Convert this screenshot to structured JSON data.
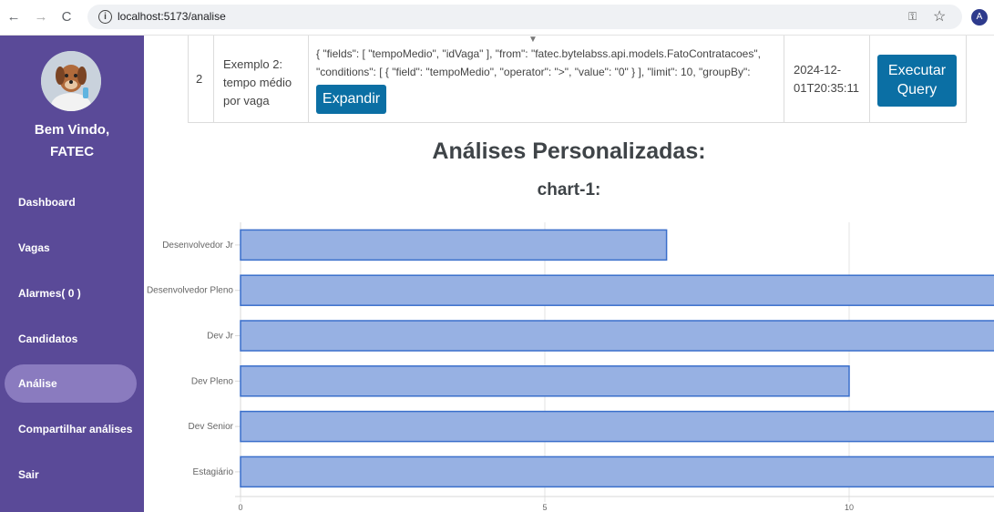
{
  "browser": {
    "url": "localhost:5173/analise",
    "profile_initial": "A"
  },
  "sidebar": {
    "welcome_line1": "Bem Vindo,",
    "welcome_line2": "FATEC",
    "items": [
      {
        "label": "Dashboard"
      },
      {
        "label": "Vagas"
      },
      {
        "label": "Alarmes( 0 )"
      },
      {
        "label": "Candidatos"
      },
      {
        "label": "Análise"
      },
      {
        "label": "Compartilhar análises"
      },
      {
        "label": "Sair"
      }
    ]
  },
  "query_row": {
    "index": "2",
    "name_lines": [
      "Exemplo 2:",
      "tempo médio",
      "por vaga"
    ],
    "query_line1": "{ \"fields\": [ \"tempoMedio\", \"idVaga\" ], \"from\": \"fatec.bytelabss.api.models.FatoContratacoes\",",
    "query_line2": "\"conditions\": [ { \"field\": \"tempoMedio\", \"operator\": \">\", \"value\": \"0\" } ], \"limit\": 10, \"groupBy\":",
    "expand_label": "Expandir",
    "date_lines": [
      "2024-12-",
      "01T20:35:11"
    ],
    "execute_lines": [
      "Executar",
      "Query"
    ]
  },
  "page": {
    "section_title": "Análises Personalizadas:"
  },
  "chart_data": {
    "type": "bar",
    "orientation": "horizontal",
    "title": "chart-1:",
    "categories": [
      "Desenvolvedor Jr",
      "Desenvolvedor Pleno",
      "Dev Jr",
      "Dev Pleno",
      "Dev Senior",
      "Estagiário"
    ],
    "values": [
      7,
      13,
      22,
      10,
      16,
      22
    ],
    "xlim": [
      0,
      24
    ],
    "xticks": [
      0,
      5,
      10,
      15,
      20
    ],
    "grid": true,
    "bar_fill": "#97b1e3",
    "bar_stroke": "#3a6fcb"
  }
}
